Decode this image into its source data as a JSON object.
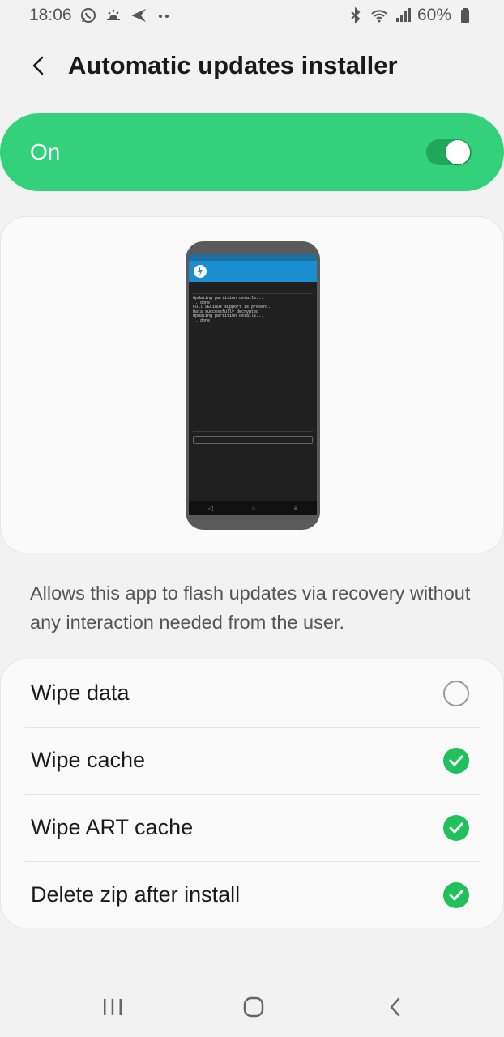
{
  "status_bar": {
    "time": "18:06",
    "battery": "60%",
    "left_icons": [
      "whatsapp-icon",
      "weather-icon",
      "send-icon",
      "more-dots-icon"
    ],
    "right_icons": [
      "bluetooth-icon",
      "wifi-icon",
      "signal-icon",
      "battery-icon"
    ]
  },
  "header": {
    "title": "Automatic updates installer",
    "back_icon": "back-arrow-icon"
  },
  "master_switch": {
    "label": "On",
    "enabled": true,
    "color": "#33d17a"
  },
  "preview": {
    "log_lines": [
      "Updating partition details...",
      "...done",
      "Full SELinux support is present.",
      "Data successfully decrypted",
      "Updating partition details...",
      "...done"
    ]
  },
  "description": "Allows this app to flash updates via recovery without any interaction needed from the user.",
  "options": [
    {
      "label": "Wipe data",
      "checked": false
    },
    {
      "label": "Wipe cache",
      "checked": true
    },
    {
      "label": "Wipe ART cache",
      "checked": true
    },
    {
      "label": "Delete zip after install",
      "checked": true
    }
  ],
  "nav_bar": {
    "icons": [
      "recent-apps-icon",
      "home-icon",
      "back-icon"
    ]
  },
  "colors": {
    "accent": "#33d17a",
    "check": "#20c05c",
    "background": "#f2f2f2"
  }
}
